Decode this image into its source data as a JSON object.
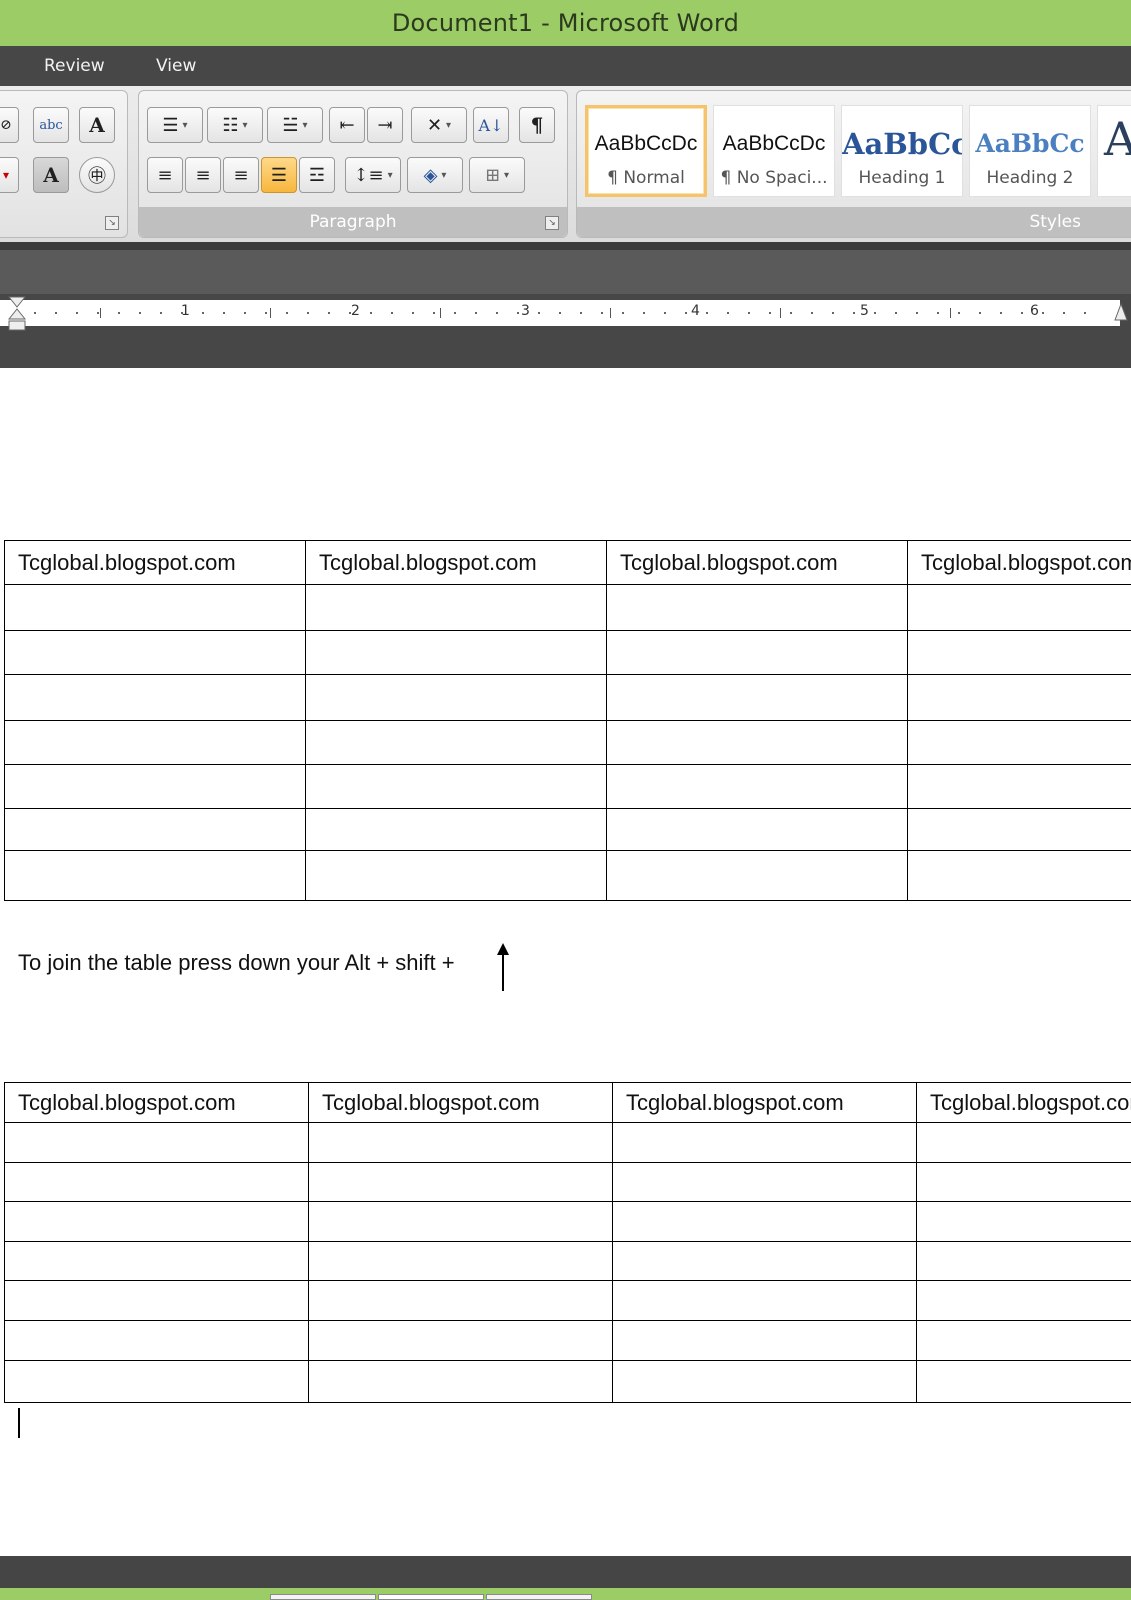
{
  "window": {
    "title": "Document1 - Microsoft Word"
  },
  "tabs": [
    {
      "label": "Review"
    },
    {
      "label": "View"
    }
  ],
  "ribbon": {
    "groups": {
      "paragraph": "Paragraph",
      "styles": "Styles"
    },
    "proofing_icons": {
      "abc": "abc",
      "pilcrow": "¶"
    },
    "styles": [
      {
        "sample": "AaBbCcDc",
        "name": "¶ Normal",
        "selected": true
      },
      {
        "sample": "AaBbCcDc",
        "name": "¶ No Spaci...",
        "selected": false
      },
      {
        "sample": "AaBbCc",
        "name": "Heading 1",
        "selected": false
      },
      {
        "sample": "AaBbCc",
        "name": "Heading 2",
        "selected": false
      },
      {
        "sample": "A",
        "name": "",
        "selected": false
      }
    ],
    "colors": {
      "heading1": "#2a5599",
      "heading2": "#4a7fc0",
      "title_green": "#9ccc65",
      "active_button": "#f7b73d"
    }
  },
  "ruler": {
    "numbers": [
      "1",
      "2",
      "3",
      "4",
      "5",
      "6"
    ]
  },
  "document": {
    "table1": {
      "header": [
        "Tcglobal.blogspot.com",
        "Tcglobal.blogspot.com",
        "Tcglobal.blogspot.com",
        "Tcglobal.blogspot.com"
      ],
      "empty_rows": 7
    },
    "note": "To join the table press down your Alt + shift +",
    "table2": {
      "header": [
        "Tcglobal.blogspot.com",
        "Tcglobal.blogspot.com",
        "Tcglobal.blogspot.com",
        "Tcglobal.blogspot.com"
      ],
      "empty_rows": 7
    }
  }
}
